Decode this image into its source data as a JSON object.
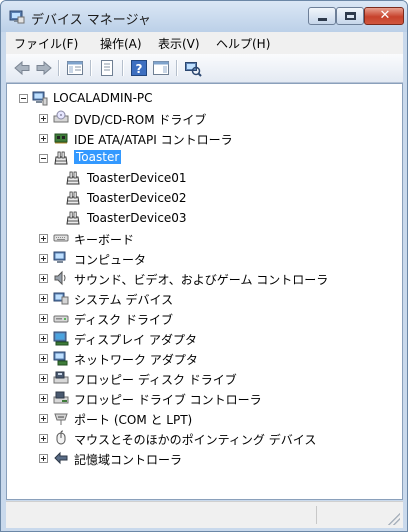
{
  "window": {
    "title": "デバイス マネージャ"
  },
  "menu": [
    "ファイル(F)",
    "操作(A)",
    "表示(V)",
    "ヘルプ(H)"
  ],
  "tree": {
    "root": "LOCALADMIN-PC",
    "categories": [
      {
        "label": "DVD/CD-ROM ドライブ",
        "icon": "dvd-drive-icon",
        "expanded": false
      },
      {
        "label": "IDE ATA/ATAPI コントローラ",
        "icon": "ide-controller-icon",
        "expanded": false
      },
      {
        "label": "Toaster",
        "icon": "toaster-icon",
        "expanded": true,
        "selected": true,
        "children": [
          "ToasterDevice01",
          "ToasterDevice02",
          "ToasterDevice03"
        ]
      },
      {
        "label": "キーボード",
        "icon": "keyboard-icon",
        "expanded": false
      },
      {
        "label": "コンピュータ",
        "icon": "computer-icon",
        "expanded": false
      },
      {
        "label": "サウンド、ビデオ、およびゲーム コントローラ",
        "icon": "speaker-icon",
        "expanded": false
      },
      {
        "label": "システム デバイス",
        "icon": "system-device-icon",
        "expanded": false
      },
      {
        "label": "ディスク ドライブ",
        "icon": "disk-drive-icon",
        "expanded": false
      },
      {
        "label": "ディスプレイ アダプタ",
        "icon": "display-adapter-icon",
        "expanded": false
      },
      {
        "label": "ネットワーク アダプタ",
        "icon": "network-adapter-icon",
        "expanded": false
      },
      {
        "label": "フロッピー ディスク ドライブ",
        "icon": "floppy-drive-icon",
        "expanded": false
      },
      {
        "label": "フロッピー ドライブ コントローラ",
        "icon": "floppy-controller-icon",
        "expanded": false
      },
      {
        "label": "ポート (COM と LPT)",
        "icon": "port-icon",
        "expanded": false
      },
      {
        "label": "マウスとそのほかのポインティング デバイス",
        "icon": "mouse-icon",
        "expanded": false
      },
      {
        "label": "記憶域コントローラ",
        "icon": "storage-controller-icon",
        "expanded": false
      }
    ]
  },
  "colors": {
    "selection": "#3399ff",
    "titlebar": "#c9d9ec"
  }
}
